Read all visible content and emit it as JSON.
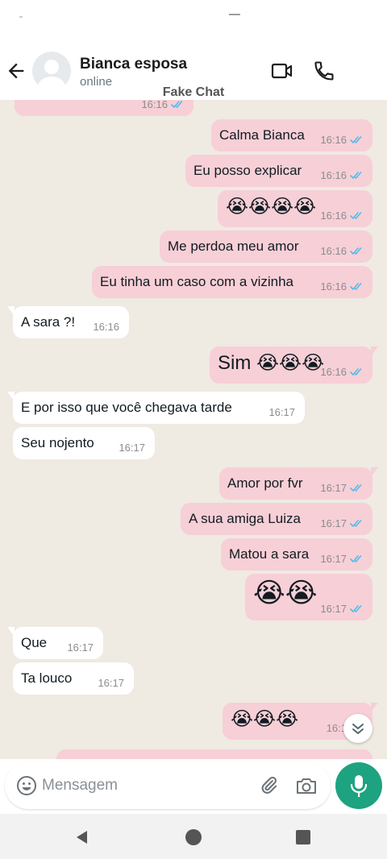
{
  "header": {
    "contact_name": "Bianca esposa",
    "status": "online",
    "watermark": "Fake Chat"
  },
  "messages": [
    {
      "dir": "out",
      "text": "",
      "time": "16:16",
      "read": true,
      "kind": "partial"
    },
    {
      "dir": "out",
      "text": "Calma Bianca",
      "time": "16:16",
      "read": true,
      "kind": "text"
    },
    {
      "dir": "out",
      "text": "Eu posso explicar",
      "time": "16:16",
      "read": true,
      "kind": "text"
    },
    {
      "dir": "out",
      "text": "😭😭😭😭",
      "time": "16:16",
      "read": true,
      "kind": "emoji"
    },
    {
      "dir": "out",
      "text": "Me perdoa meu amor",
      "time": "16:16",
      "read": true,
      "kind": "text"
    },
    {
      "dir": "out",
      "text": "Eu tinha um caso com a vizinha",
      "time": "16:16",
      "read": true,
      "kind": "text"
    },
    {
      "dir": "in",
      "text": "A sara ?!",
      "time": "16:16",
      "kind": "text"
    },
    {
      "dir": "out",
      "text": "Sim 😭😭😭",
      "time": "16:16",
      "read": true,
      "kind": "emoji"
    },
    {
      "dir": "in",
      "text": "E por isso que você chegava tarde",
      "time": "16:17",
      "kind": "text"
    },
    {
      "dir": "in",
      "text": "Seu nojento",
      "time": "16:17",
      "kind": "text"
    },
    {
      "dir": "out",
      "text": "Amor por fvr",
      "time": "16:17",
      "read": true,
      "kind": "text"
    },
    {
      "dir": "out",
      "text": "A sua amiga Luiza",
      "time": "16:17",
      "read": true,
      "kind": "text"
    },
    {
      "dir": "out",
      "text": "Matou a sara",
      "time": "16:17",
      "read": true,
      "kind": "text"
    },
    {
      "dir": "out",
      "text": "😭😭",
      "time": "16:17",
      "read": true,
      "kind": "big"
    },
    {
      "dir": "in",
      "text": "Que",
      "time": "16:17",
      "kind": "text"
    },
    {
      "dir": "in",
      "text": "Ta louco",
      "time": "16:17",
      "kind": "text"
    },
    {
      "dir": "out",
      "text": "😭😭😭",
      "time": "16:1",
      "read": true,
      "kind": "emoji"
    },
    {
      "dir": "out",
      "text": "",
      "time": "",
      "read": false,
      "kind": "partial"
    }
  ],
  "composer": {
    "placeholder": "Mensagem"
  },
  "icons": {
    "back": "arrow-left-icon",
    "video": "video-camera-icon",
    "call": "phone-icon",
    "emoji": "emoji-smiley-icon",
    "attach": "paperclip-icon",
    "camera": "camera-icon",
    "mic": "microphone-icon",
    "scroll_down": "double-chevron-down-icon",
    "read_receipt": "double-check-icon"
  },
  "colors": {
    "outgoing_bubble": "#f7cfd7",
    "incoming_bubble": "#ffffff",
    "chat_background": "#efeae2",
    "read_check": "#53bdeb",
    "mic_button": "#1da37f"
  }
}
